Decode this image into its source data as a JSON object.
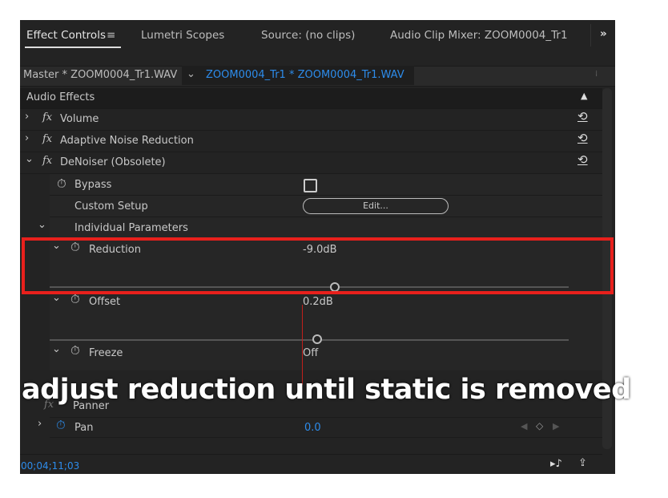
{
  "tabs": [
    {
      "label": "Effect Controls",
      "active": true
    },
    {
      "label": "Lumetri Scopes"
    },
    {
      "label": "Source: (no clips)"
    },
    {
      "label": "Audio Clip Mixer: ZOOM0004_Tr1"
    }
  ],
  "overflow_label": "»",
  "source": {
    "master": "Master * ZOOM0004_Tr1.WAV",
    "clip": "ZOOM0004_Tr1 * ZOOM0004_Tr1.WAV"
  },
  "section": "Audio Effects",
  "effects": [
    {
      "label": "Volume",
      "expanded": false
    },
    {
      "label": "Adaptive Noise Reduction",
      "expanded": false
    },
    {
      "label": "DeNoiser (Obsolete)",
      "expanded": true
    }
  ],
  "fx_label": "fx",
  "params": {
    "bypass": "Bypass",
    "custom_setup": "Custom Setup",
    "edit_button": "Edit...",
    "individual": "Individual Parameters",
    "reduction": {
      "label": "Reduction",
      "value": "-9.0dB"
    },
    "offset": {
      "label": "Offset",
      "value": "0.2dB"
    },
    "freeze": {
      "label": "Freeze",
      "value": "Off"
    }
  },
  "panner": {
    "label": "Panner",
    "pan_label": "Pan",
    "pan_value": "0.0"
  },
  "caption": "adjust reduction until static is removed",
  "timecode": "00;04;11;03",
  "colors": {
    "accent": "#2d8ceb",
    "highlight": "#e8201c",
    "panel": "#232323"
  }
}
